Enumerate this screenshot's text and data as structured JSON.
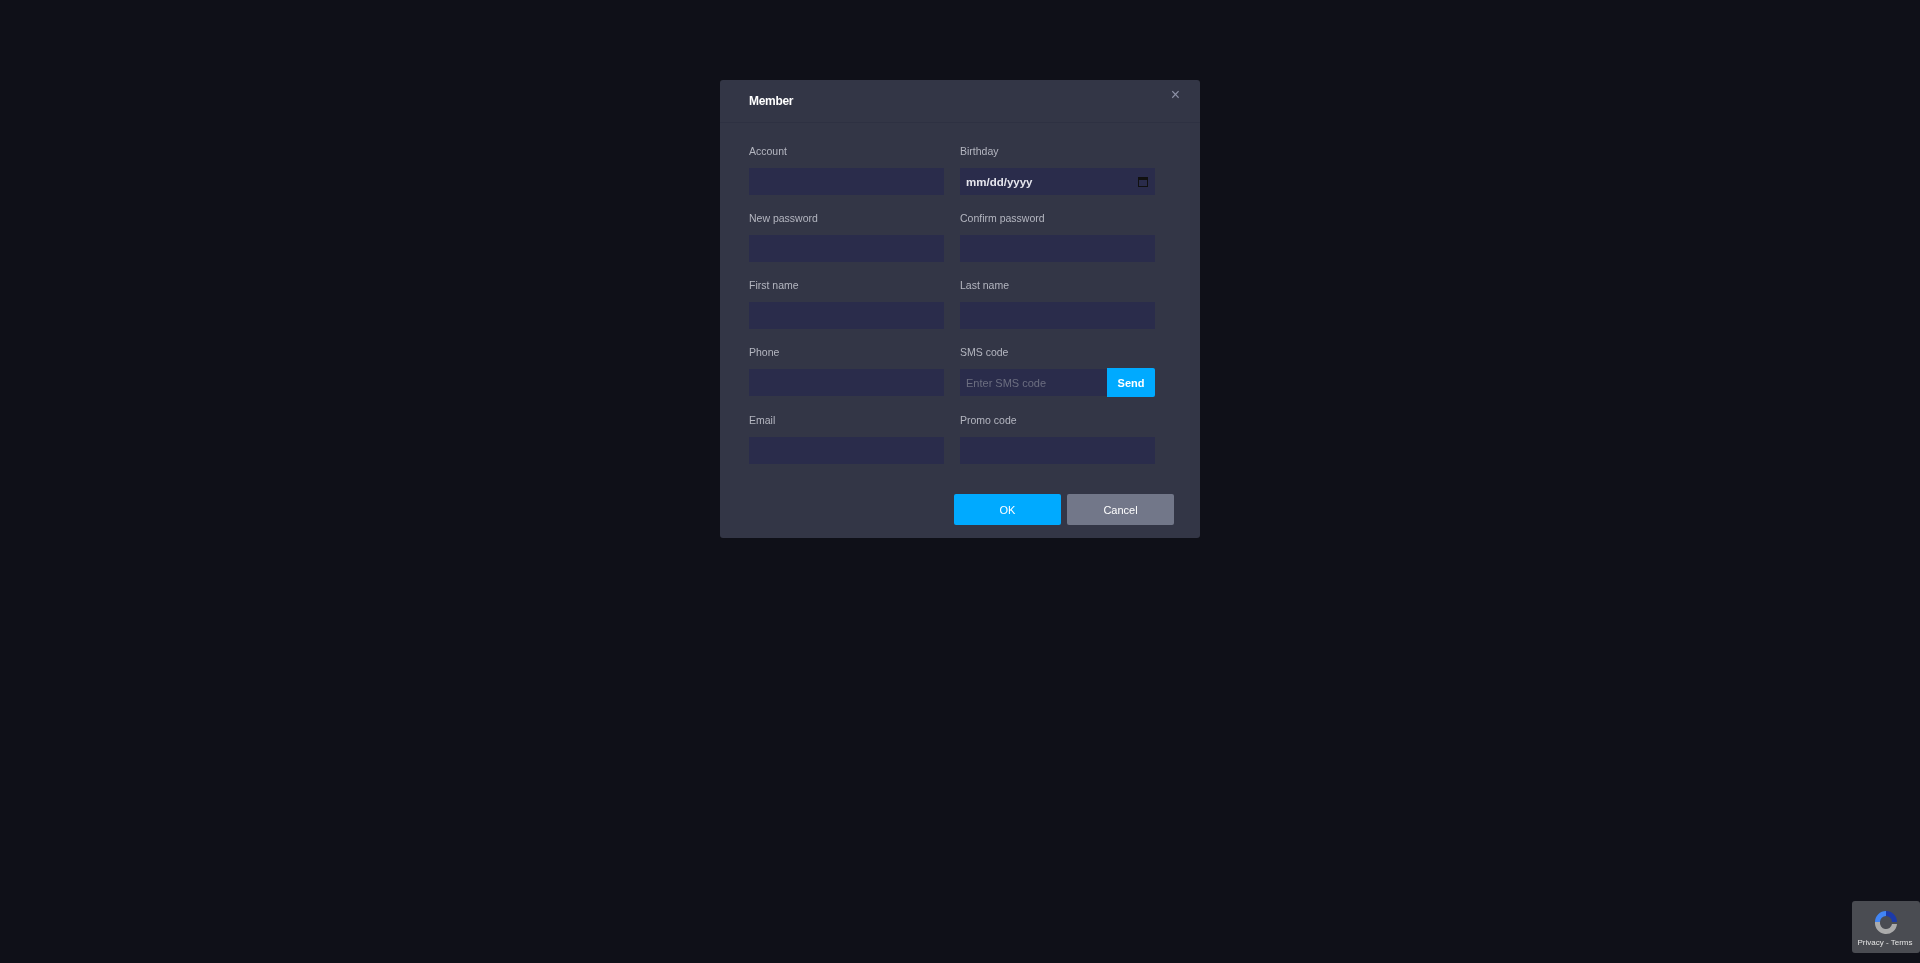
{
  "dialog": {
    "title": "Member",
    "close": "×",
    "fields": [
      {
        "kind": "text",
        "label": "Account"
      },
      {
        "kind": "date",
        "label": "Birthday",
        "value": "mm/dd/yyyy"
      },
      {
        "kind": "text",
        "label": "New password"
      },
      {
        "kind": "text",
        "label": "Confirm password"
      },
      {
        "kind": "text",
        "label": "First name"
      },
      {
        "kind": "text",
        "label": "Last name"
      },
      {
        "kind": "text",
        "label": "Phone"
      },
      {
        "kind": "sms",
        "label": "SMS code",
        "placeholder": "Enter SMS code",
        "button": "Send"
      },
      {
        "kind": "text",
        "label": "Email"
      },
      {
        "kind": "text",
        "label": "Promo code"
      }
    ],
    "buttons": [
      {
        "label": "OK",
        "kind": "primary"
      },
      {
        "label": "Cancel",
        "kind": "secondary"
      }
    ]
  },
  "recaptcha": {
    "links": "Privacy - Terms"
  }
}
